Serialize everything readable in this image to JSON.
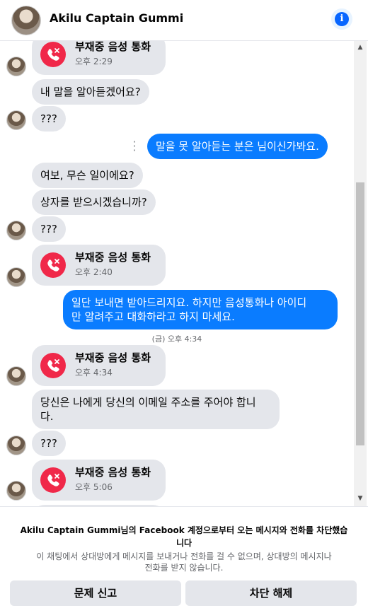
{
  "header": {
    "title": "Akilu Captain Gummi",
    "info_icon": "info-icon"
  },
  "call_label": "부재중 음성 통화",
  "messages": {
    "call1_time": "오후 2:29",
    "in1": "내 말을 알아듣겠어요?",
    "in2": "???",
    "out1": "말을 못 알아듣는 분은 님이신가봐요.",
    "in3": "여보, 무슨 일이에요?",
    "in4": "상자를 받으시겠습니까?",
    "in5": "???",
    "call2_time": "오후 2:40",
    "out2": "일단 보내면 받아드리지요. 하지만 음성통화나 아이디\n만 알려주고 대화하라고 하지 마세요.",
    "stamp1": "(금) 오후 4:34",
    "call3_time": "오후 4:34",
    "in6": "당신은 나에게 당신의 이메일 주소를 주어야 합니\n다.",
    "in7": "???",
    "call4_time": "오후 5:06"
  },
  "footer": {
    "notice_title": "Akilu Captain Gummi님의 Facebook 계정으로부터 오는 메시지와 전화를 차단했습\n니다",
    "notice_body": "이 채팅에서 상대방에게 메시지를 보내거나 전화를 걸 수 없으며, 상대방의 메시지나\n전화를 받지 않습니다.",
    "report_label": "문제 신고",
    "unblock_label": "차단 해제"
  },
  "colors": {
    "outgoing": "#0a7cff",
    "incoming": "#e4e6eb",
    "missed_call": "#f02849",
    "accent": "#0866ff"
  }
}
